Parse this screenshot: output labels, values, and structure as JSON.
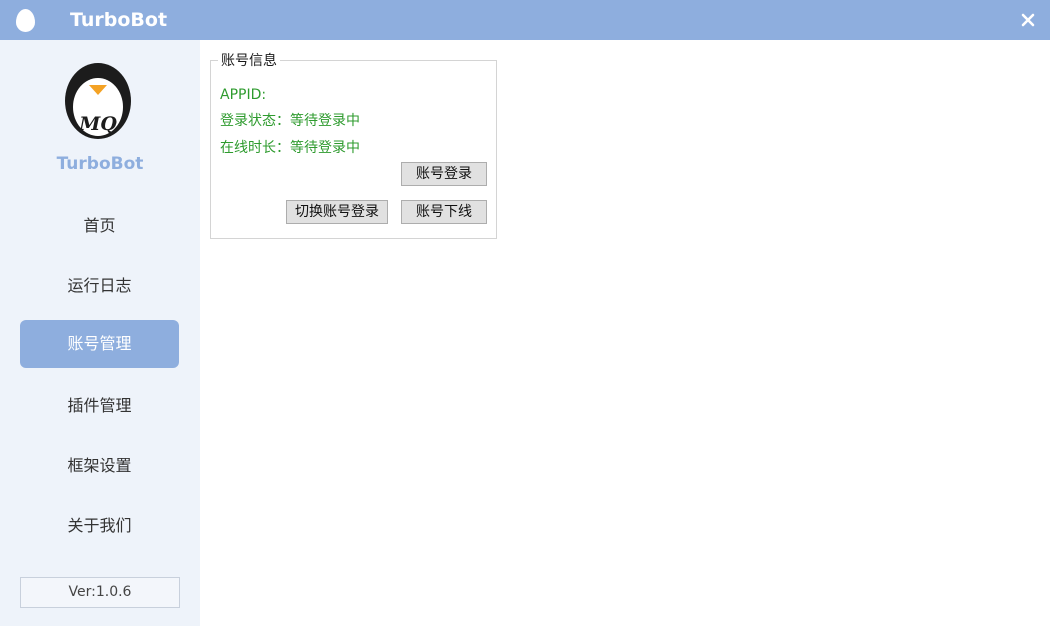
{
  "window": {
    "title": "TurboBot",
    "accent_color": "#8eaede"
  },
  "sidebar": {
    "brand": "TurboBot",
    "items": [
      {
        "label": "首页",
        "active": false
      },
      {
        "label": "运行日志",
        "active": false
      },
      {
        "label": "账号管理",
        "active": true
      },
      {
        "label": "插件管理",
        "active": false
      },
      {
        "label": "框架设置",
        "active": false
      },
      {
        "label": "关于我们",
        "active": false
      }
    ],
    "version": "Ver:1.0.6"
  },
  "account": {
    "group_title": "账号信息",
    "appid": "APPID:",
    "login_status": "登录状态：等待登录中",
    "online_time": "在线时长：等待登录中",
    "text_color": "#2e9b2e",
    "login_button": "账号登录",
    "switch_button": "切换账号登录",
    "logout_button": "账号下线"
  },
  "icons": {
    "title": "egg-icon",
    "close": "close-icon",
    "avatar": "mq-penguin-logo"
  }
}
